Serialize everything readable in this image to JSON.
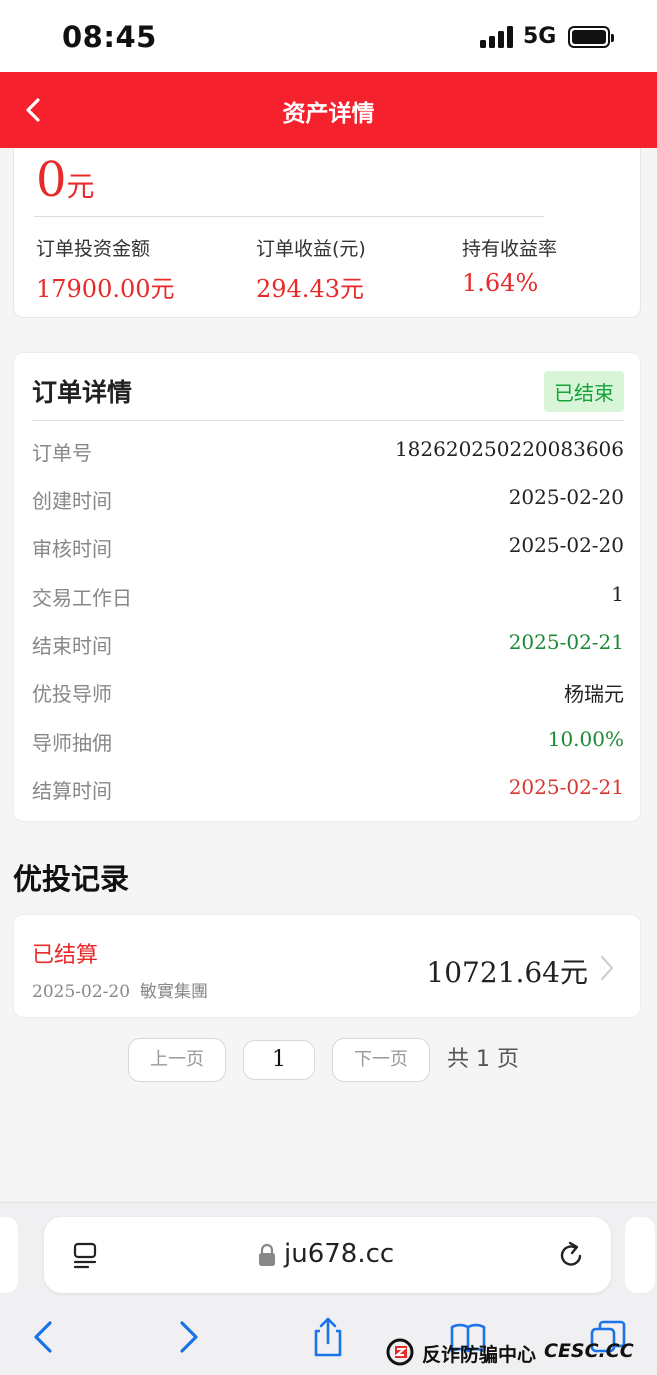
{
  "status_bar": {
    "time": "08:45",
    "network": "5G"
  },
  "nav": {
    "title": "资产详情"
  },
  "summary": {
    "total_value": "0",
    "total_unit": "元",
    "stats": [
      {
        "label": "订单投资金额",
        "value": "17900.00元"
      },
      {
        "label": "订单收益(元)",
        "value": "294.43元"
      },
      {
        "label": "持有收益率",
        "value": "1.64%"
      }
    ]
  },
  "order_detail": {
    "title": "订单详情",
    "status": "已结束",
    "rows": [
      {
        "label": "订单号",
        "value": "182620250220083606"
      },
      {
        "label": "创建时间",
        "value": "2025-02-20"
      },
      {
        "label": "审核时间",
        "value": "2025-02-20"
      },
      {
        "label": "交易工作日",
        "value": "1"
      },
      {
        "label": "结束时间",
        "value": "2025-02-21"
      },
      {
        "label": "优投导师",
        "value": "杨瑞元"
      },
      {
        "label": "导师抽佣",
        "value": "10.00%"
      },
      {
        "label": "结算时间",
        "value": "2025-02-21"
      }
    ]
  },
  "records": {
    "title": "优投记录",
    "items": [
      {
        "status": "已结算",
        "date": "2025-02-20",
        "company": "敏實集團",
        "amount": "10721.64",
        "unit": "元"
      }
    ]
  },
  "pagination": {
    "prev": "上一页",
    "current": "1",
    "next": "下一页",
    "total": "共 1 页"
  },
  "browser": {
    "url": "ju678.cc"
  },
  "watermark": {
    "text": "反诈防骗中心",
    "domain": "CESC.CC"
  },
  "colors": {
    "brand_red": "#f5212d",
    "value_red": "#e82a2a",
    "green": "#1b8a35",
    "badge_green": "#15a33a"
  }
}
